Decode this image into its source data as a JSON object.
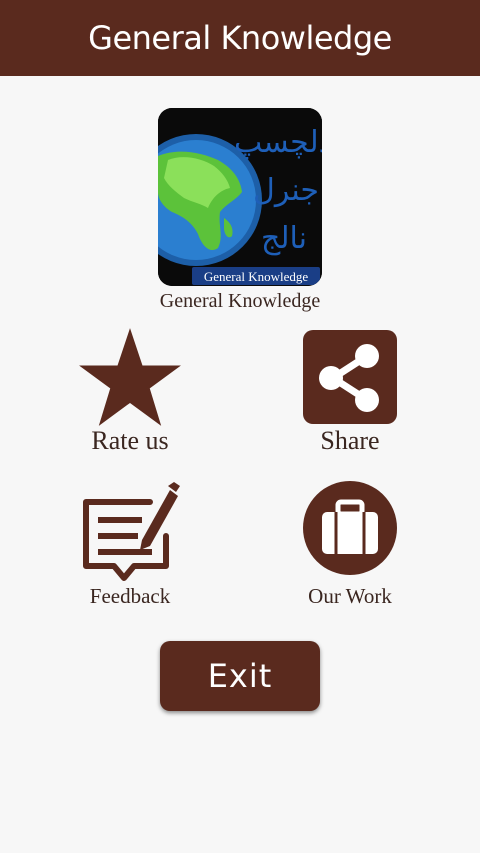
{
  "appbar": {
    "title": "General Knowledge"
  },
  "logo": {
    "urdu_line_1": "دلچسپ",
    "urdu_line_2": "جنرل",
    "urdu_line_3": "نالج",
    "banner_text": "General Knowledge",
    "caption": "General Knowledge"
  },
  "actions": {
    "rate": {
      "label": "Rate us",
      "icon": "star-icon"
    },
    "share": {
      "label": "Share",
      "icon": "share-icon"
    },
    "feedback": {
      "label": "Feedback",
      "icon": "feedback-icon"
    },
    "work": {
      "label": "Our Work",
      "icon": "briefcase-icon"
    }
  },
  "exit": {
    "label": "Exit"
  },
  "colors": {
    "brand": "#5a2a1e",
    "background": "#f7f7f7"
  }
}
